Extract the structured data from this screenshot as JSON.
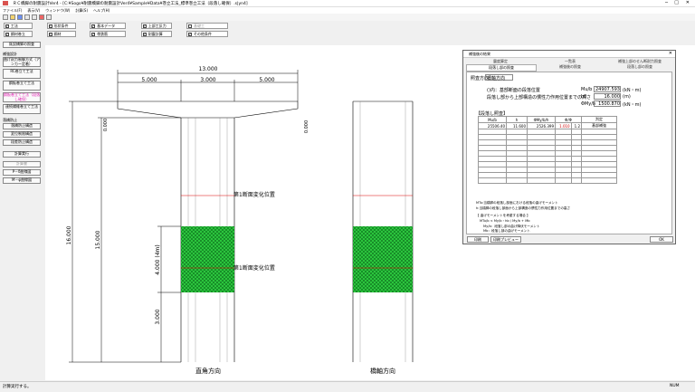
{
  "window": {
    "title": "ＲＣ橋脚の耐震設計Ver4 - [C:¥Sogo¥耐震橋脚の耐震設計Ver4¥Sample¥Data¥巻立工法_標準巻立工法（段落し確保）.s|yn4]"
  },
  "menu": [
    "ファイル(F)",
    "表示(V)",
    "ウィンドウ(W)",
    "計算(S)",
    "ヘルプ(H)"
  ],
  "conditions_row1": [
    {
      "label": "工法",
      "checked": true
    },
    {
      "label": "形状条件",
      "checked": true
    },
    {
      "label": "基本データ",
      "checked": true
    },
    {
      "label": "上部工反力",
      "checked": true
    },
    {
      "label": "基礎工",
      "checked": false,
      "disabled": true
    }
  ],
  "conditions_row2": [
    {
      "label": "鋼材巻立",
      "checked": true
    },
    {
      "label": "鋼材",
      "checked": true
    },
    {
      "label": "帯鉄筋",
      "checked": true
    },
    {
      "label": "耐震計算",
      "checked": true
    },
    {
      "label": "その他条件",
      "checked": true
    }
  ],
  "sidebar": {
    "top_button": "既設橋脚の照査",
    "group1_label": "補強設計",
    "buttons1": [
      {
        "label": "曲げ耐力制御方式（アンカー定着）",
        "style": "normal"
      },
      {
        "label": "RC巻立て工法",
        "style": "normal"
      },
      {
        "label": "鋼板巻立て工法",
        "style": "normal"
      },
      {
        "label": "鋼板巻立て工法（段落し確保）",
        "style": "pink"
      },
      {
        "label": "連続繊維巻立て工法",
        "style": "normal"
      }
    ],
    "group2_label": "落橋防止",
    "buttons2": [
      {
        "label": "落橋防止構造",
        "style": "normal"
      },
      {
        "label": "変位制限構造",
        "style": "normal"
      },
      {
        "label": "段差防止構造",
        "style": "normal"
      }
    ],
    "calc_button": "計算実行",
    "buttons3": [
      {
        "label": "計算書",
        "style": "dis"
      },
      {
        "label": "P－δ曲線図",
        "style": "normal"
      },
      {
        "label": "M－φ曲線図",
        "style": "normal"
      }
    ]
  },
  "drawing": {
    "dims_top": [
      "13.000",
      "5.000",
      "3.000",
      "5.000"
    ],
    "dim_beam_left": "0.000",
    "dim_beam_right": "0.000",
    "dim_total_height": "16.000",
    "dim_column_height": "15.000",
    "dim_mesh": "4.000 (4m)",
    "dim_bottom": "3.000",
    "section_change_1": "第1断面変化位置",
    "section_change_2": "第1断面変化位置",
    "view_left_label": "直角方向",
    "view_right_label": "橋軸方向",
    "mesh_color": "#2ecc40"
  },
  "dialog": {
    "title": "補強後の結果",
    "tabs_row1": [
      "震度算定",
      "一覧表",
      "補強上部のせん断耐力照査"
    ],
    "tabs_row2": [
      "段落し部の照査",
      "補強後の照査",
      "段落し部の照査"
    ],
    "direction_label": "照査方向",
    "direction_value": "橋軸方向",
    "line1_label": "()内：基部断面の段落位置",
    "line1_key": "Mu/b",
    "line1_value": "24907.593",
    "line1_unit": "(kN・m)",
    "line2_label": "段落し部から上部構造の慣性力作用位置までの高さ",
    "line2_key": "h0",
    "line2_value": "16.000",
    "line2_unit": "(m)",
    "line3_key": "ΦMy/b",
    "line3_value": "1500.870",
    "line3_unit": "(kN・m)",
    "table_label": "【段落し照査】",
    "table_headers": [
      "Mu/b",
      "h",
      "ΦMy/b/h",
      "Φ/Φ",
      "判定"
    ],
    "table_row": [
      "25506.40",
      "11.600",
      "2526.399",
      "1.010",
      "1.2",
      "基部補強"
    ],
    "note1": "MTu:当橋脚の段落し部面における段落の曲げモーメント",
    "note2": "h:当橋脚の段落し部面から上部構造の慣性力作用位置までの高さ",
    "note3": "【 曲げモーメントを考慮する場合 】",
    "note4": "MTu/b < My/b・hb / My/b + Mb",
    "note5": "My/b：段落し部の曲げ降伏モーメント",
    "note6": "Mb：段落し部の曲げモーメント",
    "btn_print": "印刷",
    "btn_preview": "印刷プレビュー",
    "btn_ok": "OK"
  },
  "status": {
    "left": "計算実行する。",
    "right": "NUM"
  }
}
